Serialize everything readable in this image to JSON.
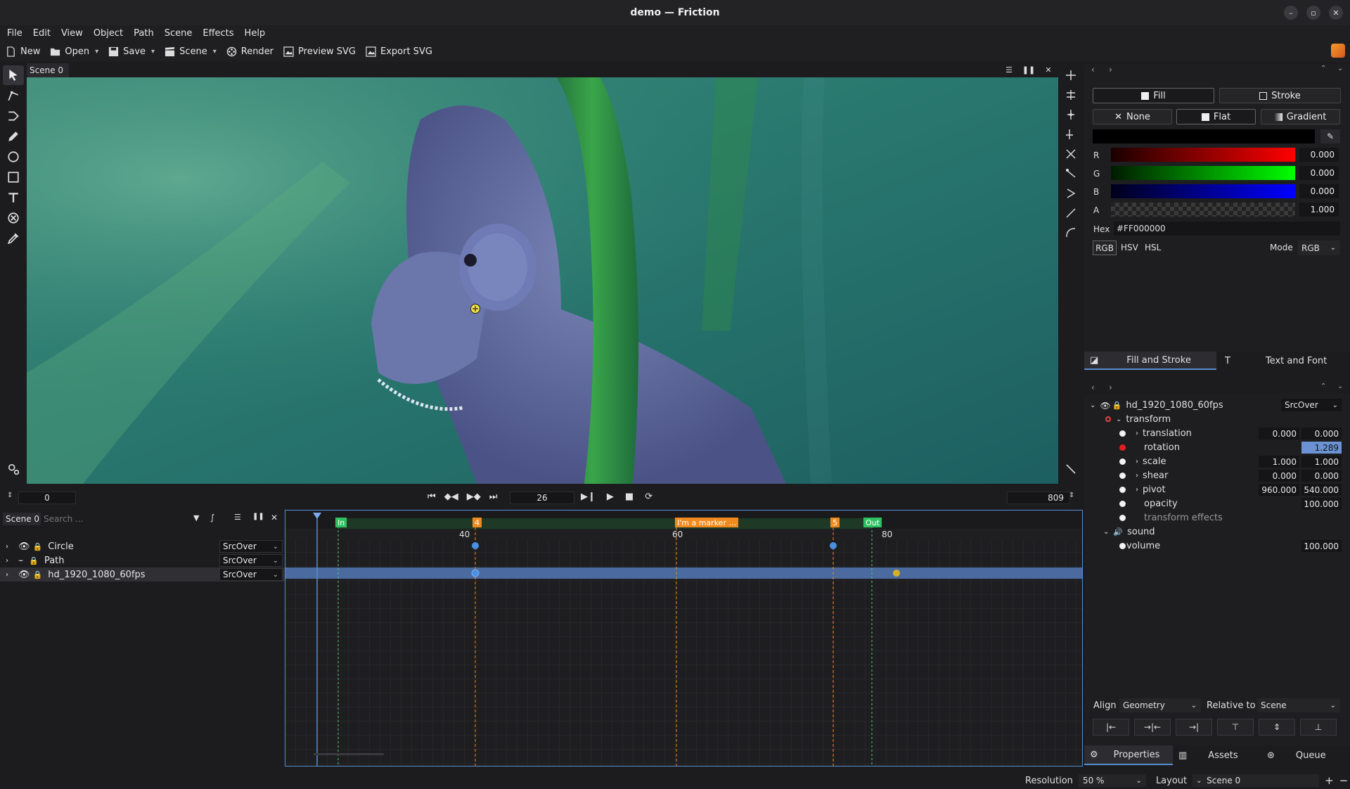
{
  "window": {
    "title": "demo — Friction"
  },
  "menu": [
    "File",
    "Edit",
    "View",
    "Object",
    "Path",
    "Scene",
    "Effects",
    "Help"
  ],
  "toolbar": {
    "new": "New",
    "open": "Open",
    "save": "Save",
    "scene": "Scene",
    "render": "Render",
    "preview_svg": "Preview SVG",
    "export_svg": "Export SVG"
  },
  "canvas": {
    "scene_tab": "Scene 0"
  },
  "transport": {
    "start_frame": "0",
    "current_frame": "26",
    "end_frame": "809"
  },
  "timeline": {
    "scene_label": "Scene 0",
    "search_placeholder": "Search ...",
    "layers": [
      {
        "name": "Circle",
        "blend": "SrcOver"
      },
      {
        "name": "Path",
        "blend": "SrcOver"
      },
      {
        "name": "hd_1920_1080_60fps",
        "blend": "SrcOver"
      }
    ],
    "ruler_labels": [
      "40",
      "60",
      "80"
    ],
    "markers": {
      "in": "In",
      "m4": "4",
      "marker": "I'm a marker ...",
      "m5": "5",
      "out": "Out"
    }
  },
  "fill_stroke": {
    "fill_tab": "Fill",
    "stroke_tab": "Stroke",
    "paint_none": "None",
    "paint_flat": "Flat",
    "paint_gradient": "Gradient",
    "channels": [
      {
        "label": "R",
        "value": "0.000"
      },
      {
        "label": "G",
        "value": "0.000"
      },
      {
        "label": "B",
        "value": "0.000"
      },
      {
        "label": "A",
        "value": "1.000"
      }
    ],
    "hex_label": "Hex",
    "hex_value": "#FF000000",
    "modes": [
      "RGB",
      "HSV",
      "HSL"
    ],
    "mode_label": "Mode",
    "mode_value": "RGB",
    "tab_fill_stroke": "Fill and Stroke",
    "tab_text_font": "Text and Font"
  },
  "properties": {
    "layer_name": "hd_1920_1080_60fps",
    "layer_blend": "SrcOver",
    "transform": "transform",
    "translation": {
      "label": "translation",
      "x": "0.000",
      "y": "0.000"
    },
    "rotation": {
      "label": "rotation",
      "value": "1.289"
    },
    "scale": {
      "label": "scale",
      "x": "1.000",
      "y": "1.000"
    },
    "shear": {
      "label": "shear",
      "x": "0.000",
      "y": "0.000"
    },
    "pivot": {
      "label": "pivot",
      "x": "960.000",
      "y": "540.000"
    },
    "opacity": {
      "label": "opacity",
      "value": "100.000"
    },
    "transform_effects": "transform effects",
    "sound": "sound",
    "volume": {
      "label": "volume",
      "value": "100.000"
    }
  },
  "align": {
    "label": "Align",
    "value": "Geometry",
    "relative_label": "Relative to",
    "relative_value": "Scene"
  },
  "bottom_tabs": {
    "properties": "Properties",
    "assets": "Assets",
    "queue": "Queue"
  },
  "status": {
    "resolution_label": "Resolution",
    "resolution_value": "50 %",
    "layout_label": "Layout",
    "layout_value": "Scene 0"
  }
}
